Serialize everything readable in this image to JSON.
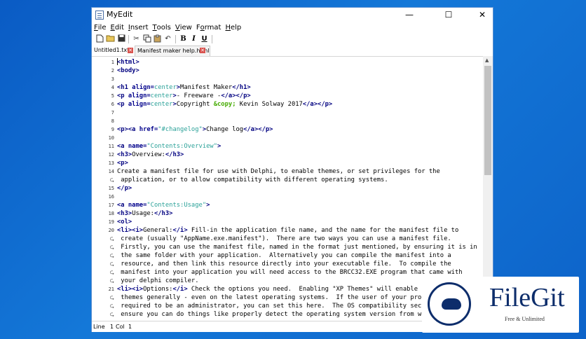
{
  "window": {
    "title": "MyEdit",
    "controls": {
      "minimize": "—",
      "maximize": "☐",
      "close": "✕"
    }
  },
  "menu": [
    {
      "label": "File",
      "key": "F"
    },
    {
      "label": "Edit",
      "key": "E"
    },
    {
      "label": "Insert",
      "key": "I"
    },
    {
      "label": "Tools",
      "key": "T"
    },
    {
      "label": "View",
      "key": "V"
    },
    {
      "label": "Format",
      "key": "o"
    },
    {
      "label": "Help",
      "key": "H"
    }
  ],
  "toolbar": {
    "new_icon": "new-file-icon",
    "open_icon": "open-folder-icon",
    "save_icon": "save-icon",
    "cut_icon": "cut-icon",
    "copy_icon": "copy-icon",
    "paste_icon": "paste-icon",
    "undo_icon": "undo-icon",
    "bold": "B",
    "italic": "I",
    "underline": "U"
  },
  "tabs": [
    {
      "label": "Untitled1.txt",
      "active": false
    },
    {
      "label": "Manifest maker help.html",
      "active": true
    }
  ],
  "editor_lines": [
    {
      "n": "1",
      "html": "<span class='t'>&lt;html&gt;</span>"
    },
    {
      "n": "2",
      "html": "<span class='t'>&lt;body&gt;</span>"
    },
    {
      "n": "3",
      "html": ""
    },
    {
      "n": "4",
      "html": "<span class='t'>&lt;h1 </span><span class='a'>align=</span><span class='v'>center</span><span class='t'>&gt;</span>Manifest Maker<span class='t'>&lt;/h1&gt;</span>"
    },
    {
      "n": "5",
      "html": "<span class='t'>&lt;p </span><span class='a'>align=</span><span class='v'>center</span><span class='t'>&gt;</span>- Freeware -<span class='t'>&lt;/a&gt;&lt;/p&gt;</span>"
    },
    {
      "n": "6",
      "html": "<span class='t'>&lt;p </span><span class='a'>align=</span><span class='v'>center</span><span class='t'>&gt;</span>Copyright <span class='e'>&amp;copy;</span> Kevin Solway 2017<span class='t'>&lt;/a&gt;&lt;/p&gt;</span>"
    },
    {
      "n": "7",
      "html": ""
    },
    {
      "n": "8",
      "html": ""
    },
    {
      "n": "9",
      "html": "<span class='t'>&lt;p&gt;&lt;a </span><span class='a'>href=</span><span class='v'>\"#changelog\"</span><span class='t'>&gt;</span>Change log<span class='t'>&lt;/a&gt;&lt;/p&gt;</span>"
    },
    {
      "n": "10",
      "html": ""
    },
    {
      "n": "11",
      "html": "<span class='t'>&lt;a </span><span class='a'>name=</span><span class='v'>\"Contents:Overview\"</span><span class='t'>&gt;</span>"
    },
    {
      "n": "12",
      "html": "<span class='t'>&lt;h3&gt;</span>Overview:<span class='t'>&lt;/h3&gt;</span>"
    },
    {
      "n": "13",
      "html": "<span class='t'>&lt;p&gt;</span>"
    },
    {
      "n": "14",
      "html": "Create a manifest file for use with Delphi, to enable themes, or set privileges for the"
    },
    {
      "n": "↩",
      "html": " application, or to allow compatibility with different operating systems."
    },
    {
      "n": "15",
      "html": "<span class='t'>&lt;/p&gt;</span>"
    },
    {
      "n": "16",
      "html": ""
    },
    {
      "n": "17",
      "html": "<span class='t'>&lt;a </span><span class='a'>name=</span><span class='v'>\"Contents:Usage\"</span><span class='t'>&gt;</span>"
    },
    {
      "n": "18",
      "html": "<span class='t'>&lt;h3&gt;</span>Usage:<span class='t'>&lt;/h3&gt;</span>"
    },
    {
      "n": "19",
      "html": "<span class='t'>&lt;ol&gt;</span>"
    },
    {
      "n": "20",
      "html": "<span class='t'>&lt;li&gt;&lt;i&gt;</span>General:<span class='t'>&lt;/i&gt;</span> Fill-in the application file name, and the name for the manifest file to"
    },
    {
      "n": "↩",
      "html": " create (usually \"AppName.exe.manifest\").  There are two ways you can use a manifest file."
    },
    {
      "n": "↩",
      "html": " Firstly, you can use the manifest file, named in the format just mentioned, by ensuring it is in"
    },
    {
      "n": "↩",
      "html": " the same folder with your application.  Alternatively you can compile the manifest into a"
    },
    {
      "n": "↩",
      "html": " resource, and then link this resource directly into your executable file.  To compile the"
    },
    {
      "n": "↩",
      "html": " manifest into your application you will need access to the BRCC32.EXE program that came with"
    },
    {
      "n": "↩",
      "html": " your delphi compiler."
    },
    {
      "n": "21",
      "html": "<span class='t'>&lt;li&gt;&lt;i&gt;</span>Options:<span class='t'>&lt;/i&gt;</span> Check the options you need.  Enabling \"XP Themes\" will enable"
    },
    {
      "n": "↩",
      "html": " themes generally - even on the latest operating systems.  If the user of your pro"
    },
    {
      "n": "↩",
      "html": " required to be an administrator, you can set this here.  The OS compatibility sec"
    },
    {
      "n": "↩",
      "html": " ensure you can do things like properly detect the operating system version from w"
    }
  ],
  "status": {
    "line_label": "Line",
    "line_value": "1",
    "col_label": "Col",
    "col_value": "1"
  },
  "watermark": {
    "name": "FileGit",
    "tagline": "Free & Unlimited"
  }
}
